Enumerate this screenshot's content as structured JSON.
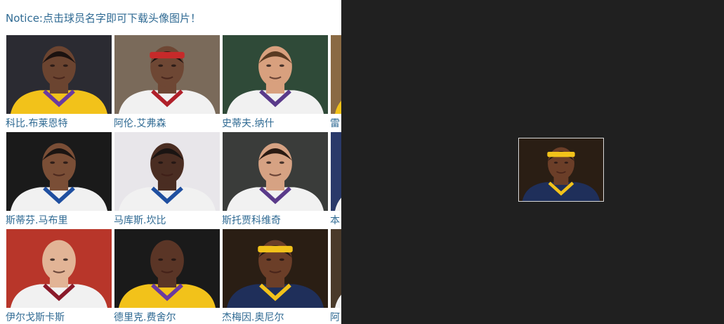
{
  "notice": "Notice:点击球员名字即可下载头像图片！",
  "rows": [
    {
      "players": [
        {
          "name": "科比.布莱恩特",
          "bg": "#2b2b32",
          "skin": "#6b4430",
          "jersey": "#f2c21a",
          "trim": "#6a3aa0",
          "headband": null,
          "hair": "#1b1210"
        },
        {
          "name": "阿伦.艾弗森",
          "bg": "#7a6a5a",
          "skin": "#6e4734",
          "jersey": "#f1f1f1",
          "trim": "#b0202a",
          "headband": "#c62a2a",
          "hair": "#1a1412"
        },
        {
          "name": "史蒂夫.纳什",
          "bg": "#2f4a38",
          "skin": "#d8a07e",
          "jersey": "#f1f1f1",
          "trim": "#5a3a8a",
          "headband": null,
          "hair": "#5a3a22"
        },
        {
          "name": "雷",
          "bg": "#8a6a44",
          "skin": "#6b4530",
          "jersey": "#f2c21a",
          "trim": "#1a3a7a",
          "headband": null,
          "hair": "#1a1412"
        }
      ]
    },
    {
      "players": [
        {
          "name": "斯蒂芬.马布里",
          "bg": "#1a1a1a",
          "skin": "#7a4e36",
          "jersey": "#f1f1f1",
          "trim": "#1f4fa0",
          "headband": null,
          "hair": "#1a1412"
        },
        {
          "name": "马库斯.坎比",
          "bg": "#e8e6ea",
          "skin": "#4a2d22",
          "jersey": "#f1f1f1",
          "trim": "#1f4fa0",
          "headband": null,
          "hair": "#1a1412"
        },
        {
          "name": "斯托贾科维奇",
          "bg": "#3a3c3a",
          "skin": "#d6a283",
          "jersey": "#f1f1f1",
          "trim": "#5a3a8a",
          "headband": null,
          "hair": "#2a1a12"
        },
        {
          "name": "本",
          "bg": "#2a3a6a",
          "skin": "#6b4530",
          "jersey": "#f1f1f1",
          "trim": "#1a3a7a",
          "headband": null,
          "hair": "#1a1412"
        }
      ]
    },
    {
      "players": [
        {
          "name": "伊尔戈斯卡斯",
          "bg": "#b8362a",
          "skin": "#e2b496",
          "jersey": "#f1f1f1",
          "trim": "#8a1a2a",
          "headband": null,
          "hair": null
        },
        {
          "name": "德里克.费舍尔",
          "bg": "#1a1a1a",
          "skin": "#5a3526",
          "jersey": "#f2c21a",
          "trim": "#6a3aa0",
          "headband": null,
          "hair": null
        },
        {
          "name": "杰梅因.奥尼尔",
          "bg": "#2a1e14",
          "skin": "#6b3e28",
          "jersey": "#1f2f5a",
          "trim": "#f2c21a",
          "headband": "#f2c21a",
          "hair": "#1a1412"
        },
        {
          "name": "阿",
          "bg": "#4a3a2a",
          "skin": "#6b4530",
          "jersey": "#f1f1f1",
          "trim": "#8a1a2a",
          "headband": null,
          "hair": "#1a1412"
        }
      ]
    }
  ],
  "preview": {
    "bg": "#2a1e14",
    "skin": "#6b3e28",
    "jersey": "#1f2f5a",
    "trim": "#f2c21a",
    "headband": "#f2c21a",
    "hair": "#1a1412"
  }
}
